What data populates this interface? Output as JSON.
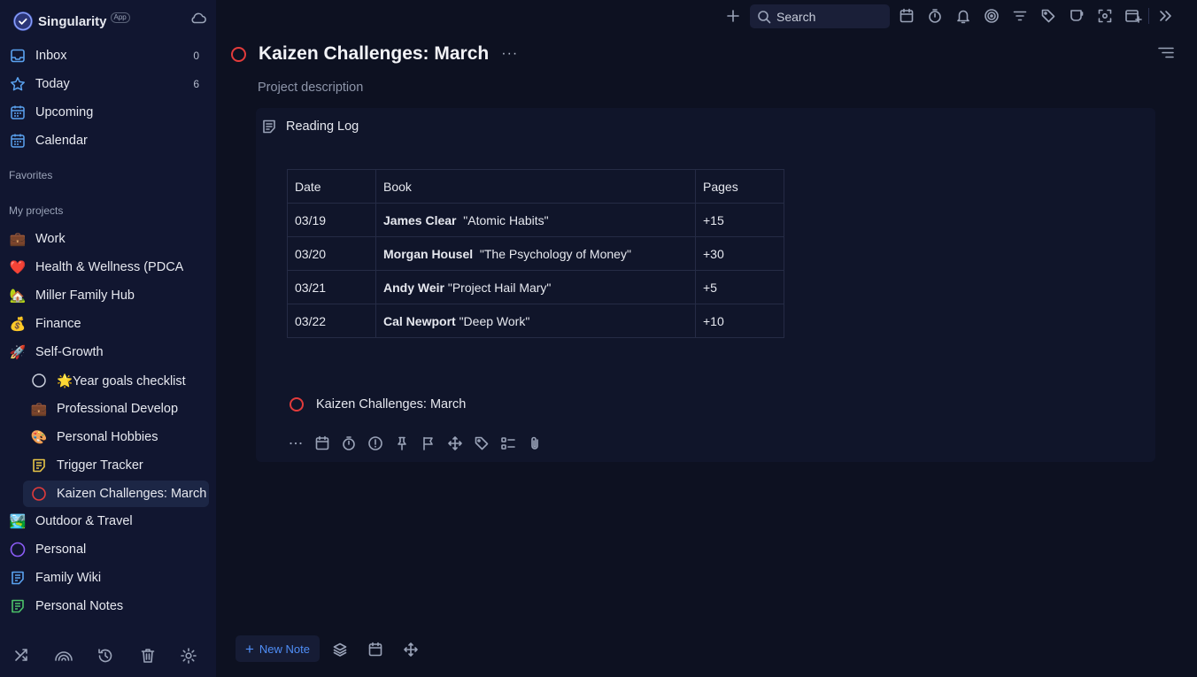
{
  "app": {
    "name": "Singularity",
    "badge": "App"
  },
  "sidebar": {
    "nav": [
      {
        "label": "Inbox",
        "count": "0",
        "icon": "inbox-icon"
      },
      {
        "label": "Today",
        "count": "6",
        "icon": "star-icon"
      },
      {
        "label": "Upcoming",
        "count": "",
        "icon": "calendar-range-icon"
      },
      {
        "label": "Calendar",
        "count": "",
        "icon": "calendar-icon"
      }
    ],
    "favorites_label": "Favorites",
    "projects_label": "My projects",
    "projects": [
      {
        "label": "Work",
        "emoji": "💼"
      },
      {
        "label": "Health & Wellness (PDCA",
        "emoji": "❤️"
      },
      {
        "label": "Miller Family Hub",
        "emoji": "🏡"
      },
      {
        "label": "Finance",
        "emoji": "💰"
      },
      {
        "label": "Self-Growth",
        "emoji": "🚀"
      },
      {
        "label": "🌟Year goals checklist",
        "emoji": ""
      },
      {
        "label": "Professional Develop",
        "emoji": "💼"
      },
      {
        "label": "Personal Hobbies",
        "emoji": "🎨"
      },
      {
        "label": "Trigger Tracker",
        "emoji": ""
      },
      {
        "label": "Kaizen Challenges: March",
        "emoji": ""
      },
      {
        "label": "Outdoor & Travel",
        "emoji": "🏞️"
      },
      {
        "label": "Personal",
        "emoji": ""
      },
      {
        "label": "Family Wiki",
        "emoji": ""
      },
      {
        "label": "Personal Notes",
        "emoji": ""
      }
    ]
  },
  "toolbar": {
    "search_placeholder": "Search"
  },
  "main": {
    "title": "Kaizen Challenges: March",
    "more": "···",
    "description": "Project description",
    "note": {
      "title": "Reading Log",
      "table": {
        "headers": [
          "Date",
          "Book",
          "Pages"
        ],
        "rows": [
          {
            "date": "03/19",
            "author": "James Clear",
            "book": "  \"Atomic Habits\"",
            "pages": "+15"
          },
          {
            "date": "03/20",
            "author": "Morgan Housel",
            "book": "  \"The Psychology of Money\"",
            "pages": "+30"
          },
          {
            "date": "03/21",
            "author": "Andy Weir",
            "book": " \"Project Hail Mary\"",
            "pages": "+5"
          },
          {
            "date": "03/22",
            "author": "Cal Newport",
            "book": " \"Deep Work\"",
            "pages": "+10"
          }
        ]
      },
      "task_label": "Kaizen Challenges: March"
    }
  },
  "bottom": {
    "new_note_label": "New Note",
    "new_note_plus": "+"
  },
  "colors": {
    "accent": "#4f8ef7",
    "danger": "#e23b3b",
    "sidebar_bg": "#111630",
    "main_bg": "#0d1121"
  }
}
